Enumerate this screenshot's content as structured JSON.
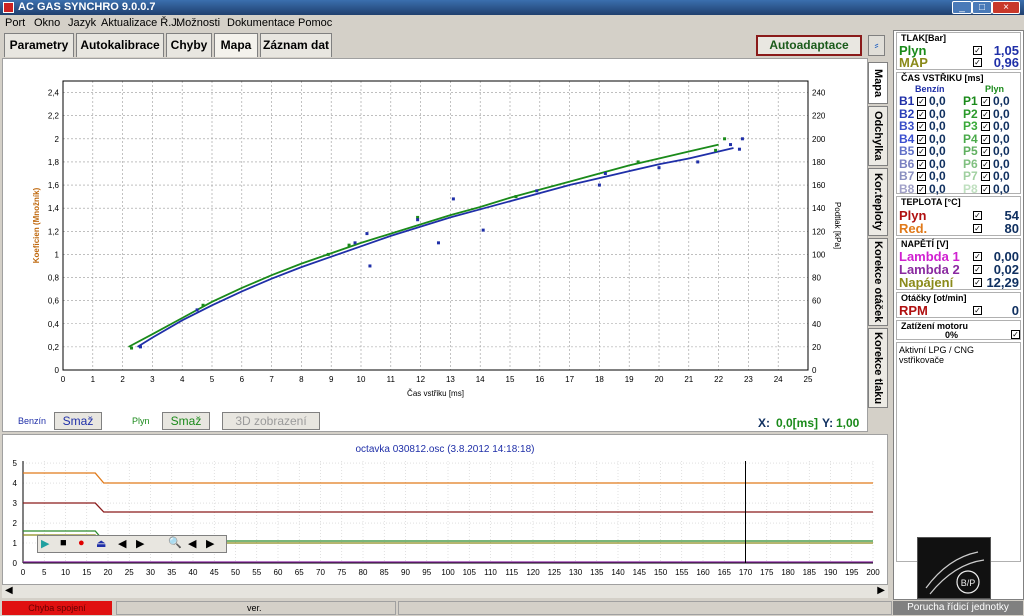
{
  "window": {
    "title": "AC GAS SYNCHRO  9.0.0.7",
    "min": "_",
    "max": "□",
    "close": "×"
  },
  "menu": [
    "Port",
    "Okno",
    "Jazyk",
    "Aktualizace Ř.J.",
    "Možnosti",
    "Dokumentace",
    "Pomoc"
  ],
  "tabs": [
    "Parametry",
    "Autokalibrace",
    "Chyby",
    "Mapa",
    "Záznam dat"
  ],
  "active_tab": "Mapa",
  "autoadaptace": "Autoadaptace",
  "small_button": "⸗",
  "side_tabs": [
    "Mapa",
    "Odchylka",
    "Kor.teploty",
    "Korekce otáček",
    "Korekce tlaku"
  ],
  "chart_data": {
    "type": "scatter",
    "xlabel": "Čas vstřiku [ms]",
    "ylabel": "Koeficien (Množník)",
    "y2label": "Podtlak [kPa]",
    "xlim": [
      0,
      25
    ],
    "ylim": [
      0,
      2.5
    ],
    "y2lim": [
      0,
      250
    ],
    "xticks": [
      "0",
      "1",
      "2",
      "3",
      "4",
      "5",
      "6",
      "7",
      "8",
      "9",
      "10",
      "11",
      "12",
      "13",
      "14",
      "15",
      "16",
      "17",
      "18",
      "19",
      "20",
      "21",
      "22",
      "23",
      "24",
      "25"
    ],
    "yticks": [
      "0",
      "0,2",
      "0,4",
      "0,6",
      "0,8",
      "1",
      "1,2",
      "1,4",
      "1,6",
      "1,8",
      "2",
      "2,2",
      "2,4"
    ],
    "y2ticks": [
      "0",
      "20",
      "40",
      "60",
      "80",
      "100",
      "120",
      "140",
      "160",
      "180",
      "200",
      "220",
      "240"
    ],
    "grid": true,
    "series": [
      {
        "name": "",
        "color": "#1f2fa8",
        "x": [
          2.5,
          3,
          4,
          5,
          6,
          7,
          8,
          9,
          10,
          11,
          12,
          13,
          14,
          15,
          16,
          17,
          18,
          19,
          20,
          21,
          22,
          22.5
        ],
        "y": [
          0.2,
          0.28,
          0.43,
          0.56,
          0.68,
          0.79,
          0.89,
          0.98,
          1.07,
          1.16,
          1.24,
          1.32,
          1.39,
          1.46,
          1.53,
          1.6,
          1.66,
          1.72,
          1.78,
          1.83,
          1.89,
          1.92
        ]
      },
      {
        "name": "",
        "color": "#1a8a1a",
        "x": [
          2.2,
          3,
          4,
          5,
          6,
          7,
          8,
          9,
          10,
          11,
          12,
          13,
          14,
          15,
          16,
          17,
          18,
          19,
          20,
          21,
          22
        ],
        "y": [
          0.2,
          0.31,
          0.45,
          0.59,
          0.71,
          0.82,
          0.92,
          1.01,
          1.1,
          1.18,
          1.26,
          1.34,
          1.41,
          1.49,
          1.56,
          1.63,
          1.7,
          1.77,
          1.83,
          1.89,
          1.95
        ]
      }
    ],
    "points": [
      {
        "x": 2.3,
        "y": 0.19,
        "c": "#1a8a1a"
      },
      {
        "x": 4.7,
        "y": 0.56,
        "c": "#1a8a1a"
      },
      {
        "x": 8.9,
        "y": 1.0,
        "c": "#1a8a1a"
      },
      {
        "x": 9.6,
        "y": 1.08,
        "c": "#1a8a1a"
      },
      {
        "x": 11.9,
        "y": 1.32,
        "c": "#1a8a1a"
      },
      {
        "x": 15.2,
        "y": 1.5,
        "c": "#1a8a1a"
      },
      {
        "x": 19.3,
        "y": 1.8,
        "c": "#1a8a1a"
      },
      {
        "x": 21.9,
        "y": 1.9,
        "c": "#1a8a1a"
      },
      {
        "x": 22.2,
        "y": 2.0,
        "c": "#1a8a1a"
      },
      {
        "x": 2.6,
        "y": 0.2,
        "c": "#1f2fa8"
      },
      {
        "x": 4.5,
        "y": 0.52,
        "c": "#1f2fa8"
      },
      {
        "x": 9.8,
        "y": 1.1,
        "c": "#1f2fa8"
      },
      {
        "x": 10.2,
        "y": 1.18,
        "c": "#1f2fa8"
      },
      {
        "x": 10.3,
        "y": 0.9,
        "c": "#1f2fa8"
      },
      {
        "x": 11.9,
        "y": 1.3,
        "c": "#1f2fa8"
      },
      {
        "x": 12.6,
        "y": 1.1,
        "c": "#1f2fa8"
      },
      {
        "x": 13.1,
        "y": 1.48,
        "c": "#1f2fa8"
      },
      {
        "x": 14.1,
        "y": 1.21,
        "c": "#1f2fa8"
      },
      {
        "x": 15.9,
        "y": 1.55,
        "c": "#1f2fa8"
      },
      {
        "x": 18.0,
        "y": 1.6,
        "c": "#1f2fa8"
      },
      {
        "x": 18.2,
        "y": 1.7,
        "c": "#1f2fa8"
      },
      {
        "x": 20.0,
        "y": 1.75,
        "c": "#1f2fa8"
      },
      {
        "x": 21.3,
        "y": 1.8,
        "c": "#1f2fa8"
      },
      {
        "x": 22.4,
        "y": 1.95,
        "c": "#1f2fa8"
      },
      {
        "x": 22.7,
        "y": 1.91,
        "c": "#1f2fa8"
      },
      {
        "x": 22.8,
        "y": 2.0,
        "c": "#1f2fa8"
      }
    ]
  },
  "bottom": {
    "benzin": "Benzín",
    "smaz1": "Smaž",
    "plyn": "Plyn",
    "smaz2": "Smaž",
    "zobrazeni": "3D zobrazení",
    "xlabel": "X:",
    "xval": "0,0[ms]",
    "ylabel": "Y:",
    "yval": "1,00"
  },
  "osc": {
    "title": "octavka 030812.osc  (3.8.2012 14:18:18)",
    "xticks": [
      "0",
      "5",
      "10",
      "15",
      "20",
      "25",
      "30",
      "35",
      "40",
      "45",
      "50",
      "55",
      "60",
      "65",
      "70",
      "75",
      "80",
      "85",
      "90",
      "95",
      "100",
      "105",
      "110",
      "115",
      "120",
      "125",
      "130",
      "135",
      "140",
      "145",
      "150",
      "155",
      "160",
      "165",
      "170",
      "175",
      "180",
      "185",
      "190",
      "195",
      "200"
    ],
    "yticks": [
      "0",
      "1",
      "2",
      "3",
      "4",
      "5"
    ],
    "cursor_x": 170,
    "lines": [
      {
        "color": "#e07a1a",
        "y0": 4.5,
        "y1": 4.0
      },
      {
        "color": "#8a1a1a",
        "y0": 3.0,
        "y1": 2.55
      },
      {
        "color": "#2a8a2a",
        "y0": 1.6,
        "y1": 1.1
      },
      {
        "color": "#8a8a1a",
        "y0": 1.4,
        "y1": 1.0
      },
      {
        "color": "#8a2aa0",
        "y0": 0.05,
        "y1": 0.05
      }
    ],
    "controls": [
      "▶",
      "■",
      "●",
      "⏏",
      "◀",
      "▶",
      "🔍",
      "◀",
      "▶"
    ]
  },
  "status": {
    "err": "Chyba spojení",
    "ver": "ver.",
    "fault": "Porucha řídicí jednotky"
  },
  "rp": {
    "tlak": {
      "title": "TLAK[Bar]",
      "plyn": "Plyn",
      "plyn_v": "1,05",
      "map": "MAP",
      "map_v": "0,96"
    },
    "cas": {
      "title": "ČAS VSTŘIKU [ms]",
      "benzin": "Benzín",
      "plyn": "Plyn",
      "rows": [
        [
          "B1",
          "0,0",
          "P1",
          "0,0"
        ],
        [
          "B2",
          "0,0",
          "P2",
          "0,0"
        ],
        [
          "B3",
          "0,0",
          "P3",
          "0,0"
        ],
        [
          "B4",
          "0,0",
          "P4",
          "0,0"
        ],
        [
          "B5",
          "0,0",
          "P5",
          "0,0"
        ],
        [
          "B6",
          "0,0",
          "P6",
          "0,0"
        ],
        [
          "B7",
          "0,0",
          "P7",
          "0,0"
        ],
        [
          "B8",
          "0,0",
          "P8",
          "0,0"
        ]
      ]
    },
    "teplota": {
      "title": "TEPLOTA  [°C]",
      "plyn": "Plyn",
      "plyn_v": "54",
      "red": "Red.",
      "red_v": "80"
    },
    "napeti": {
      "title": "NAPĚTÍ [V]",
      "l1": "Lambda 1",
      "l1_v": "0,00",
      "l2": "Lambda 2",
      "l2_v": "0,02",
      "nap": "Napájení",
      "nap_v": "12,29"
    },
    "otacky": {
      "title": "Otáčky [ot/min]",
      "rpm": "RPM",
      "rpm_v": "0"
    },
    "zatizeni": {
      "title": "Zatížení motoru",
      "val": "0%"
    },
    "aktivni": "Aktivní LPG / CNG vstřikovače",
    "logo_text": "B/P"
  },
  "colors": {
    "green": "#1a8a1a",
    "blue": "#1f2fa8",
    "orange": "#e07a1a",
    "red": "#b01010",
    "magenta": "#d020d0",
    "olive": "#8a8a1a"
  }
}
